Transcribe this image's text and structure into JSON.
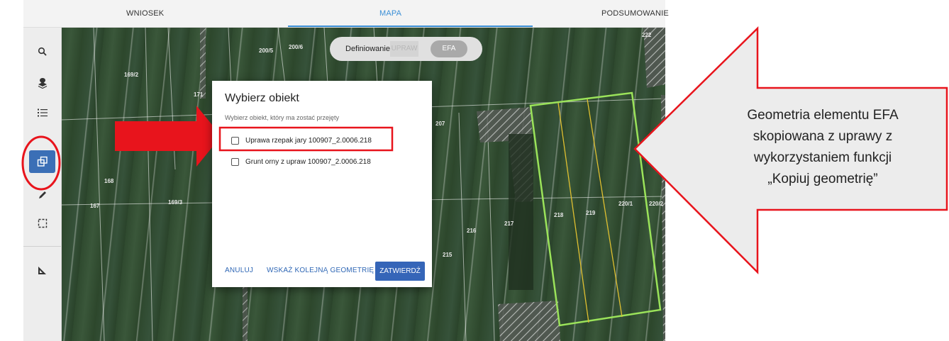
{
  "tabs": {
    "wniosek": "WNIOSEK",
    "mapa": "MAPA",
    "podsumowanie": "PODSUMOWANIE"
  },
  "sidebar": {
    "items": [
      "search-icon",
      "layers-pin-icon",
      "list-icon",
      "copy-geometry-icon",
      "pencil-icon",
      "select-rectangle-icon",
      "measure-icon"
    ],
    "active_color": "#3b6fb6"
  },
  "map": {
    "parcel_labels": [
      "169/2",
      "200/5",
      "200/6",
      "171",
      "207",
      "168",
      "167",
      "169/3",
      "215",
      "216",
      "217",
      "218",
      "219",
      "220/1",
      "220/2",
      "222"
    ]
  },
  "mode_toggle": {
    "title": "Definiowanie",
    "upraw": "UPRAW",
    "efa": "EFA"
  },
  "dialog": {
    "title": "Wybierz obiekt",
    "subtitle": "Wybierz obiekt, który ma zostać przejęty",
    "options": [
      "Uprawa rzepak jary 100907_2.0006.218",
      "Grunt orny z upraw 100907_2.0006.218"
    ],
    "cancel": "ANULUJ",
    "next_geometry": "WSKAŻ KOLEJNĄ GEOMETRIĘ",
    "confirm": "ZATWIERDŹ"
  },
  "callout": {
    "lines": [
      "Geometria elementu EFA",
      "skopiowana z uprawy z",
      "wykorzystaniem funkcji",
      "„Kopiuj geometrię”"
    ]
  },
  "colors": {
    "accent": "#3b8fd6",
    "annotation_red": "#e8141c",
    "efa_outline": "#9be35a",
    "crop_lines": "#e0c030"
  }
}
